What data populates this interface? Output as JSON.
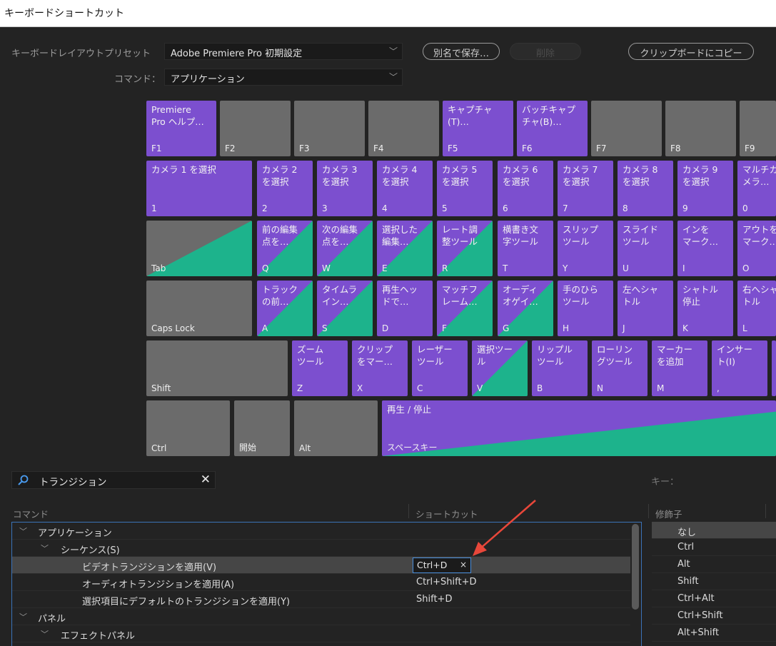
{
  "window": {
    "title": "キーボードショートカット"
  },
  "layout_preset": {
    "label": "キーボードレイアウトプリセット",
    "value": "Adobe Premiere Pro 初期設定"
  },
  "command_filter": {
    "label": "コマンド：",
    "value": "アプリケーション"
  },
  "buttons": {
    "save_as": "別名で保存…",
    "delete": "削除",
    "copy_clipboard": "クリップボードにコピー"
  },
  "keys": {
    "f1": {
      "name": "Premiere\nPro ヘルプ…",
      "cap": "F1"
    },
    "f2": {
      "cap": "F2"
    },
    "f3": {
      "cap": "F3"
    },
    "f4": {
      "cap": "F4"
    },
    "f5": {
      "name": "キャプチャ\n(T)…",
      "cap": "F5"
    },
    "f6": {
      "name": "バッチキャプ\nチャ(B)…",
      "cap": "F6"
    },
    "f7": {
      "cap": "F7"
    },
    "f8": {
      "cap": "F8"
    },
    "f9": {
      "cap": "F9"
    },
    "k1": {
      "name": "カメラ 1 を選択",
      "cap": "1"
    },
    "k2": {
      "name": "カメラ 2\nを選択",
      "cap": "2"
    },
    "k3": {
      "name": "カメラ 3\nを選択",
      "cap": "3"
    },
    "k4": {
      "name": "カメラ 4\nを選択",
      "cap": "4"
    },
    "k5": {
      "name": "カメラ 5\nを選択",
      "cap": "5"
    },
    "k6": {
      "name": "カメラ 6\nを選択",
      "cap": "6"
    },
    "k7": {
      "name": "カメラ 7\nを選択",
      "cap": "7"
    },
    "k8": {
      "name": "カメラ 8\nを選択",
      "cap": "8"
    },
    "k9": {
      "name": "カメラ 9\nを選択",
      "cap": "9"
    },
    "k0": {
      "name": "マルチカ\nメラ…",
      "cap": "0"
    },
    "tab": {
      "cap": "Tab"
    },
    "q": {
      "name": "前の編集\n点を…",
      "cap": "Q"
    },
    "w": {
      "name": "次の編集\n点を…",
      "cap": "W"
    },
    "e": {
      "name": "選択した\n編集…",
      "cap": "E"
    },
    "r": {
      "name": "レート調\n整ツール",
      "cap": "R"
    },
    "t": {
      "name": "横書き文\n字ツール",
      "cap": "T"
    },
    "y": {
      "name": "スリップ\nツール",
      "cap": "Y"
    },
    "u": {
      "name": "スライド\nツール",
      "cap": "U"
    },
    "i": {
      "name": "インを\nマーク…",
      "cap": "I"
    },
    "o": {
      "name": "アウトを\nマーク…",
      "cap": "O"
    },
    "caps": {
      "cap": "Caps Lock"
    },
    "a": {
      "name": "トラック\nの前…",
      "cap": "A"
    },
    "s": {
      "name": "タイムラ\nイン…",
      "cap": "S"
    },
    "d": {
      "name": "再生ヘッ\nドで…",
      "cap": "D"
    },
    "f": {
      "name": "マッチフ\nレーム…",
      "cap": "F"
    },
    "g": {
      "name": "オーディ\nオゲイ…",
      "cap": "G"
    },
    "h": {
      "name": "手のひら\nツール",
      "cap": "H"
    },
    "j": {
      "name": "左へシャ\nトル",
      "cap": "J"
    },
    "k": {
      "name": "シャトル\n停止",
      "cap": "K"
    },
    "l": {
      "name": "右へシャ\nトル",
      "cap": "L"
    },
    "shift": {
      "cap": "Shift"
    },
    "z": {
      "name": "ズーム\nツール",
      "cap": "Z"
    },
    "x": {
      "name": "クリップ\nをマー…",
      "cap": "X"
    },
    "c": {
      "name": "レーザー\nツール",
      "cap": "C"
    },
    "v": {
      "name": "選択ツー\nル",
      "cap": "V"
    },
    "b": {
      "name": "リップル\nツール",
      "cap": "B"
    },
    "n": {
      "name": "ローリン\nグツール",
      "cap": "N"
    },
    "m": {
      "name": "マーカー\nを追加",
      "cap": "M"
    },
    "comma": {
      "name": "インサー\nト(I)",
      "cap": ","
    },
    "ctrl": {
      "cap": "Ctrl"
    },
    "start": {
      "cap": "開始"
    },
    "alt": {
      "cap": "Alt"
    },
    "space": {
      "name": "再生 / 停止",
      "cap": "スペースキー"
    }
  },
  "search": {
    "value": "トランジション"
  },
  "key_label": "キー：",
  "columns": {
    "command": "コマンド",
    "shortcut": "ショートカット",
    "modifier": "修飾子"
  },
  "tree_rows": [
    {
      "name": "アプリケーション",
      "shortcut": ""
    },
    {
      "name": "シーケンス(S)",
      "shortcut": ""
    },
    {
      "name": "ビデオトランジションを適用(V)",
      "shortcut": "Ctrl+D"
    },
    {
      "name": "オーディオトランジションを適用(A)",
      "shortcut": "Ctrl+Shift+D"
    },
    {
      "name": "選択項目にデフォルトのトランジションを適用(Y)",
      "shortcut": "Shift+D"
    },
    {
      "name": "パネル",
      "shortcut": ""
    },
    {
      "name": "エフェクトパネル",
      "shortcut": ""
    }
  ],
  "edit_clear": "×",
  "modifiers": [
    "なし",
    "Ctrl",
    "Alt",
    "Shift",
    "Ctrl+Alt",
    "Ctrl+Shift",
    "Alt+Shift"
  ],
  "colors": {
    "command_key": "#7c4fcf",
    "modifier_key": "#1db38c",
    "plain_key": "#6b6b6b",
    "background": "#232323",
    "focus": "#3b73b8",
    "annotation_arrow": "#e8473a"
  },
  "icons": {
    "search": "magnifier-icon",
    "expand": "chevron-down-icon"
  }
}
